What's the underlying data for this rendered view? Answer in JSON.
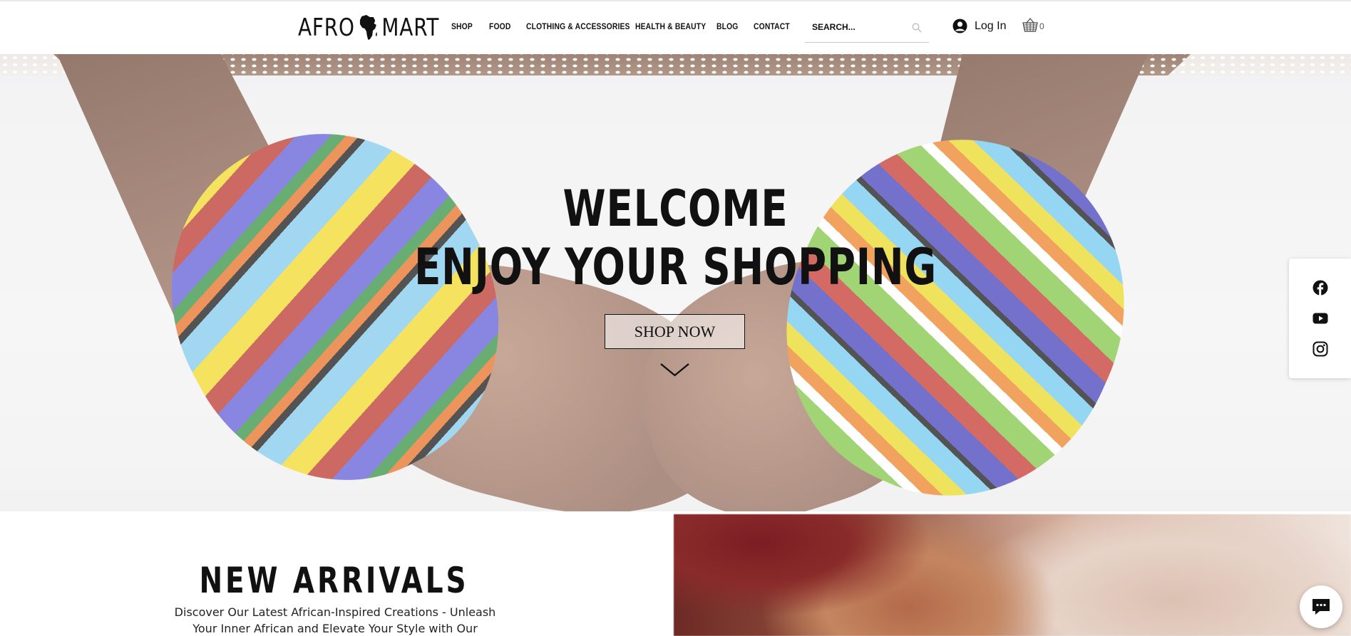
{
  "header": {
    "logo_text_left": "AFRO",
    "logo_text_right": "MART",
    "nav": [
      {
        "label": "SHOP"
      },
      {
        "label": "FOOD"
      },
      {
        "label": "CLOTHING & ACCESSORIES"
      },
      {
        "label": "HEALTH & BEAUTY"
      },
      {
        "label": "BLOG"
      },
      {
        "label": "CONTACT"
      }
    ],
    "search_placeholder": "SEARCH...",
    "login_label": "Log In",
    "cart_count": "0"
  },
  "hero": {
    "title_line1": "WELCOME",
    "title_line2": "ENJOY YOUR SHOPPING",
    "cta_label": "SHOP NOW"
  },
  "social": {
    "icons": [
      "facebook-icon",
      "youtube-icon",
      "instagram-icon"
    ]
  },
  "new_arrivals": {
    "title": "NEW ARRIVALS",
    "text_line1": "Discover Our Latest African-Inspired Creations - Unleash",
    "text_line2": "Your Inner African and Elevate Your Style with Our Unique"
  },
  "colors": {
    "text": "#111111",
    "background": "#ffffff"
  }
}
